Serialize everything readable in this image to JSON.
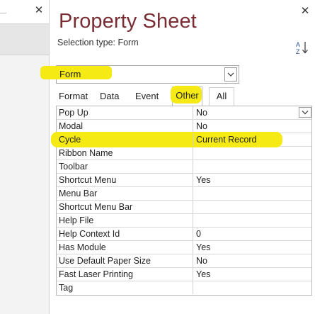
{
  "background_window": {
    "close_glyph": "✕"
  },
  "sheet": {
    "title": "Property Sheet",
    "selection_type_label": "Selection type:  Form",
    "close_glyph": "✕",
    "selector": {
      "value": "Form"
    },
    "tabs": [
      {
        "label": "Format"
      },
      {
        "label": "Data"
      },
      {
        "label": "Event"
      },
      {
        "label": "Other",
        "active": true
      },
      {
        "label": "All"
      }
    ],
    "properties": [
      {
        "name": "Pop Up",
        "value": "No"
      },
      {
        "name": "Modal",
        "value": "No"
      },
      {
        "name": "Cycle",
        "value": "Current Record"
      },
      {
        "name": "Ribbon Name",
        "value": ""
      },
      {
        "name": "Toolbar",
        "value": ""
      },
      {
        "name": "Shortcut Menu",
        "value": "Yes"
      },
      {
        "name": "Menu Bar",
        "value": ""
      },
      {
        "name": "Shortcut Menu Bar",
        "value": ""
      },
      {
        "name": "Help File",
        "value": ""
      },
      {
        "name": "Help Context Id",
        "value": "0"
      },
      {
        "name": "Has Module",
        "value": "Yes"
      },
      {
        "name": "Use Default Paper Size",
        "value": "No"
      },
      {
        "name": "Fast Laser Printing",
        "value": "Yes"
      },
      {
        "name": "Tag",
        "value": ""
      }
    ]
  },
  "colors": {
    "title": "#7a2e34",
    "highlight": "#f6ea14"
  },
  "icons": {
    "sort": "sort-az-icon",
    "dropdown": "chevron-down-icon",
    "close": "close-icon"
  }
}
